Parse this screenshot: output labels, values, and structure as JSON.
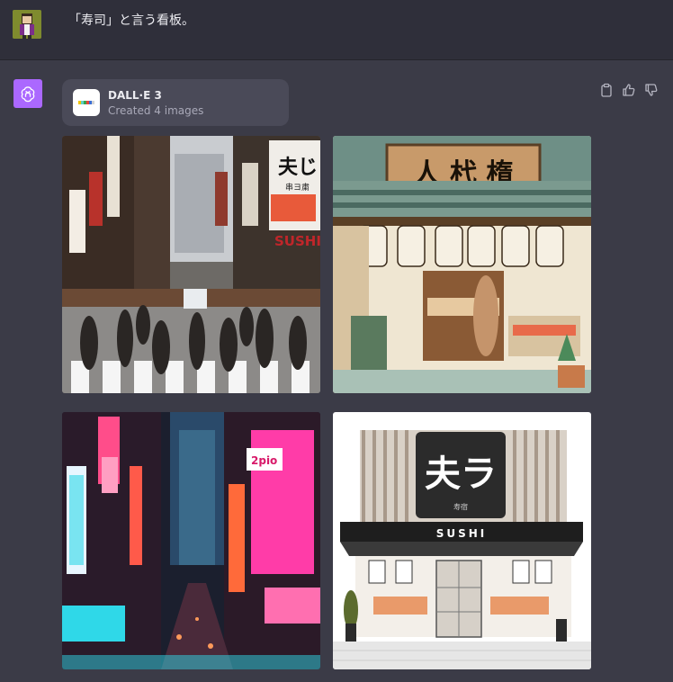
{
  "user": {
    "message": "「寿司」と言う看板。"
  },
  "assistant": {
    "tool_title": "DALL·E 3",
    "tool_subtitle": "Created 4 images"
  },
  "images": {
    "img1": {
      "sign_top": "夫じ",
      "sign_small": "串ヨ粛",
      "sign_brand": "SUSHI"
    },
    "img2": {
      "banner": "人 杙 楕"
    },
    "img3": {
      "sign_2pio": "2pio"
    },
    "img4": {
      "logo": "夫ラ",
      "logo_sub": "寿宿",
      "storefront": "SUSHI"
    }
  },
  "icons": {
    "copy": "clipboard-icon",
    "like": "thumbs-up-icon",
    "dislike": "thumbs-down-icon"
  },
  "colors": {
    "bg": "#3b3b47",
    "user_row": "#2f2f3a",
    "assistant_avatar": "#ab68ff"
  }
}
